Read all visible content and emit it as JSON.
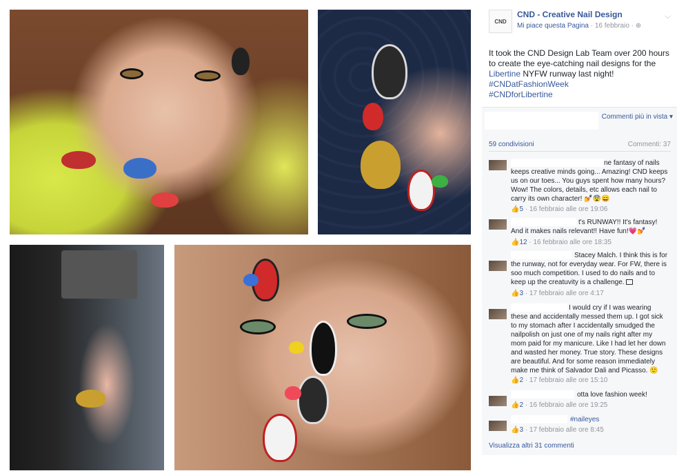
{
  "post": {
    "page_logo": "CND",
    "page_name": "CND - Creative Nail Design",
    "like_page": "Mi piace questa Pagina",
    "date": "· 16 febbraio ·",
    "privacy_icon": "globe-icon",
    "text_1": "It took the CND Design Lab Team over 200 hours to create the eye-catching nail designs for the ",
    "text_link_1": "Libertine",
    "text_2": " NYFW runway last night! ",
    "hashtag_1": "#CNDatFashionWeek",
    "hashtag_2": "#CNDforLibertine"
  },
  "comments_section": {
    "sort_label": "Commenti più in vista ▾",
    "shares": "59 condivisioni",
    "comment_count": "Commenti: 37",
    "more_comments": "Visualizza altri 31 commenti"
  },
  "comments": [
    {
      "text": "ne fantasy of nails keeps creative minds going... Amazing! CND keeps us on our toes... You guys spent how many hours? Wow! The colors, details, etc allows each nail to carry its own character! 💅😨😄",
      "likes": "5",
      "meta": " · 16 febbraio alle ore 19:06"
    },
    {
      "text": "t's RUNWAY!! It's fantasy! And it makes nails relevant!! Have fun!💗💅",
      "likes": "12",
      "meta": " · 16 febbraio alle ore 18:35"
    },
    {
      "text": "Stacey Malch. I think this is for the runway, not for everyday wear. For FW, there is soo much competition. I used to do nails and to keep up the creatuvity is a challenge.",
      "likes": "3",
      "meta": " · 17 febbraio alle ore 4:17"
    },
    {
      "text": "I would cry if I was wearing these and accidentally messed them up. I got sick to my stomach after I accidentally smudged the nailpolish on just one of my nails right after my mom paid for my manicure. Like I had let her down and wasted her money. True story. These designs are beautiful. And for some reason immediately make me think of Salvador Dali and Picasso. 🙂",
      "likes": "2",
      "meta": " · 17 febbraio alle ore 15:10"
    },
    {
      "text": "otta love fashion week!",
      "likes": "2",
      "meta": " · 16 febbraio alle ore 19:25"
    },
    {
      "text": "#naileyes",
      "likes": "3",
      "meta": " · 17 febbraio alle ore 8:45"
    }
  ],
  "colors": {
    "link_blue": "#365899",
    "meta_gray": "#90949c"
  }
}
